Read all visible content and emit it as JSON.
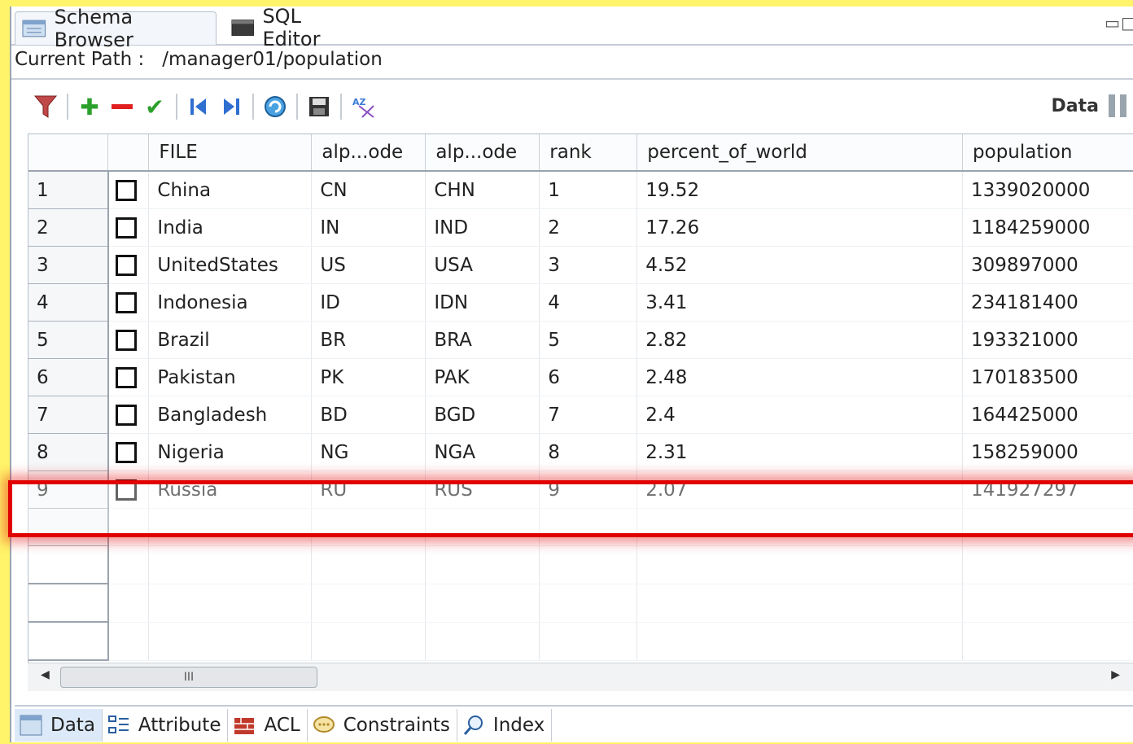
{
  "tabs": {
    "schema_browser": "Schema Browser",
    "sql_editor": "SQL Editor"
  },
  "path": {
    "label": "Current Path :",
    "value": "/manager01/population"
  },
  "toolbar": {
    "icons": [
      "filter-icon",
      "add-icon",
      "remove-icon",
      "commit-icon",
      "first-icon",
      "last-icon",
      "refresh-icon",
      "save-icon",
      "sort-icon"
    ],
    "data_label": "Data"
  },
  "grid": {
    "columns": [
      "FILE",
      "alp...ode",
      "alp...ode",
      "rank",
      "percent_of_world",
      "population"
    ],
    "rows": [
      {
        "num": "1",
        "file": "China",
        "a2": "CN",
        "a3": "CHN",
        "rank": "1",
        "pct": "19.52",
        "pop": "1339020000"
      },
      {
        "num": "2",
        "file": "India",
        "a2": "IN",
        "a3": "IND",
        "rank": "2",
        "pct": "17.26",
        "pop": "1184259000"
      },
      {
        "num": "3",
        "file": "UnitedStates",
        "a2": "US",
        "a3": "USA",
        "rank": "3",
        "pct": "4.52",
        "pop": "309897000"
      },
      {
        "num": "4",
        "file": "Indonesia",
        "a2": "ID",
        "a3": "IDN",
        "rank": "4",
        "pct": "3.41",
        "pop": "234181400"
      },
      {
        "num": "5",
        "file": "Brazil",
        "a2": "BR",
        "a3": "BRA",
        "rank": "5",
        "pct": "2.82",
        "pop": "193321000"
      },
      {
        "num": "6",
        "file": "Pakistan",
        "a2": "PK",
        "a3": "PAK",
        "rank": "6",
        "pct": "2.48",
        "pop": "170183500"
      },
      {
        "num": "7",
        "file": "Bangladesh",
        "a2": "BD",
        "a3": "BGD",
        "rank": "7",
        "pct": "2.4",
        "pop": "164425000"
      },
      {
        "num": "8",
        "file": "Nigeria",
        "a2": "NG",
        "a3": "NGA",
        "rank": "8",
        "pct": "2.31",
        "pop": "158259000"
      },
      {
        "num": "9",
        "file": "Russia",
        "a2": "RU",
        "a3": "RUS",
        "rank": "9",
        "pct": "2.07",
        "pop": "141927297"
      }
    ]
  },
  "scrollbar": {
    "thumb_grip": "III"
  },
  "bottom_tabs": [
    "Data",
    "Attribute",
    "ACL",
    "Constraints",
    "Index"
  ],
  "colors": {
    "highlight": "#e00000",
    "background": "#fff46a"
  }
}
